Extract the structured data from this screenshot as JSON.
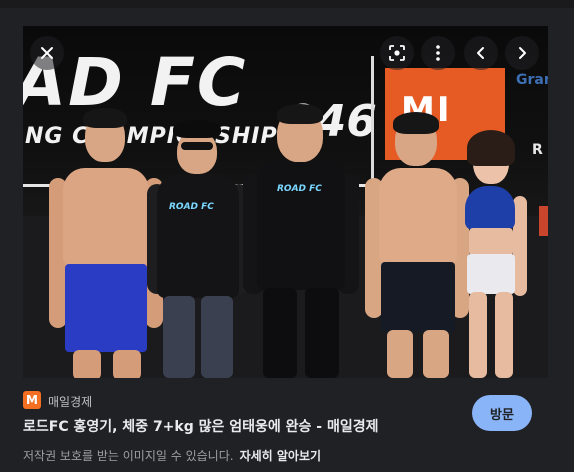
{
  "image": {
    "banner_text": "AD FC",
    "banner_subtext": "NG CHAMPIONSHIP",
    "event_number": "046",
    "sponsor_text": "MI",
    "side_brand": "Gran",
    "side_mark": "R",
    "shirt_logo": "ROAD FC"
  },
  "controls": {
    "close": "close-icon",
    "lens": "lens-icon",
    "more": "more-vert-icon",
    "prev": "chevron-left-icon",
    "next": "chevron-right-icon"
  },
  "source": {
    "icon_letter": "M",
    "name": "매일경제"
  },
  "headline": "로드FC 홍영기, 체중 7+kg 많은 엄태웅에 완승 - 매일경제",
  "copyright": {
    "notice": "저작권 보호를 받는 이미지일 수 있습니다.",
    "learn_more": "자세히 알아보기"
  },
  "visit_button": "방문",
  "colors": {
    "background": "#202124",
    "visit_button": "#8ab4f8",
    "source_icon": "#f36f21",
    "sponsor": "#e65a23"
  }
}
